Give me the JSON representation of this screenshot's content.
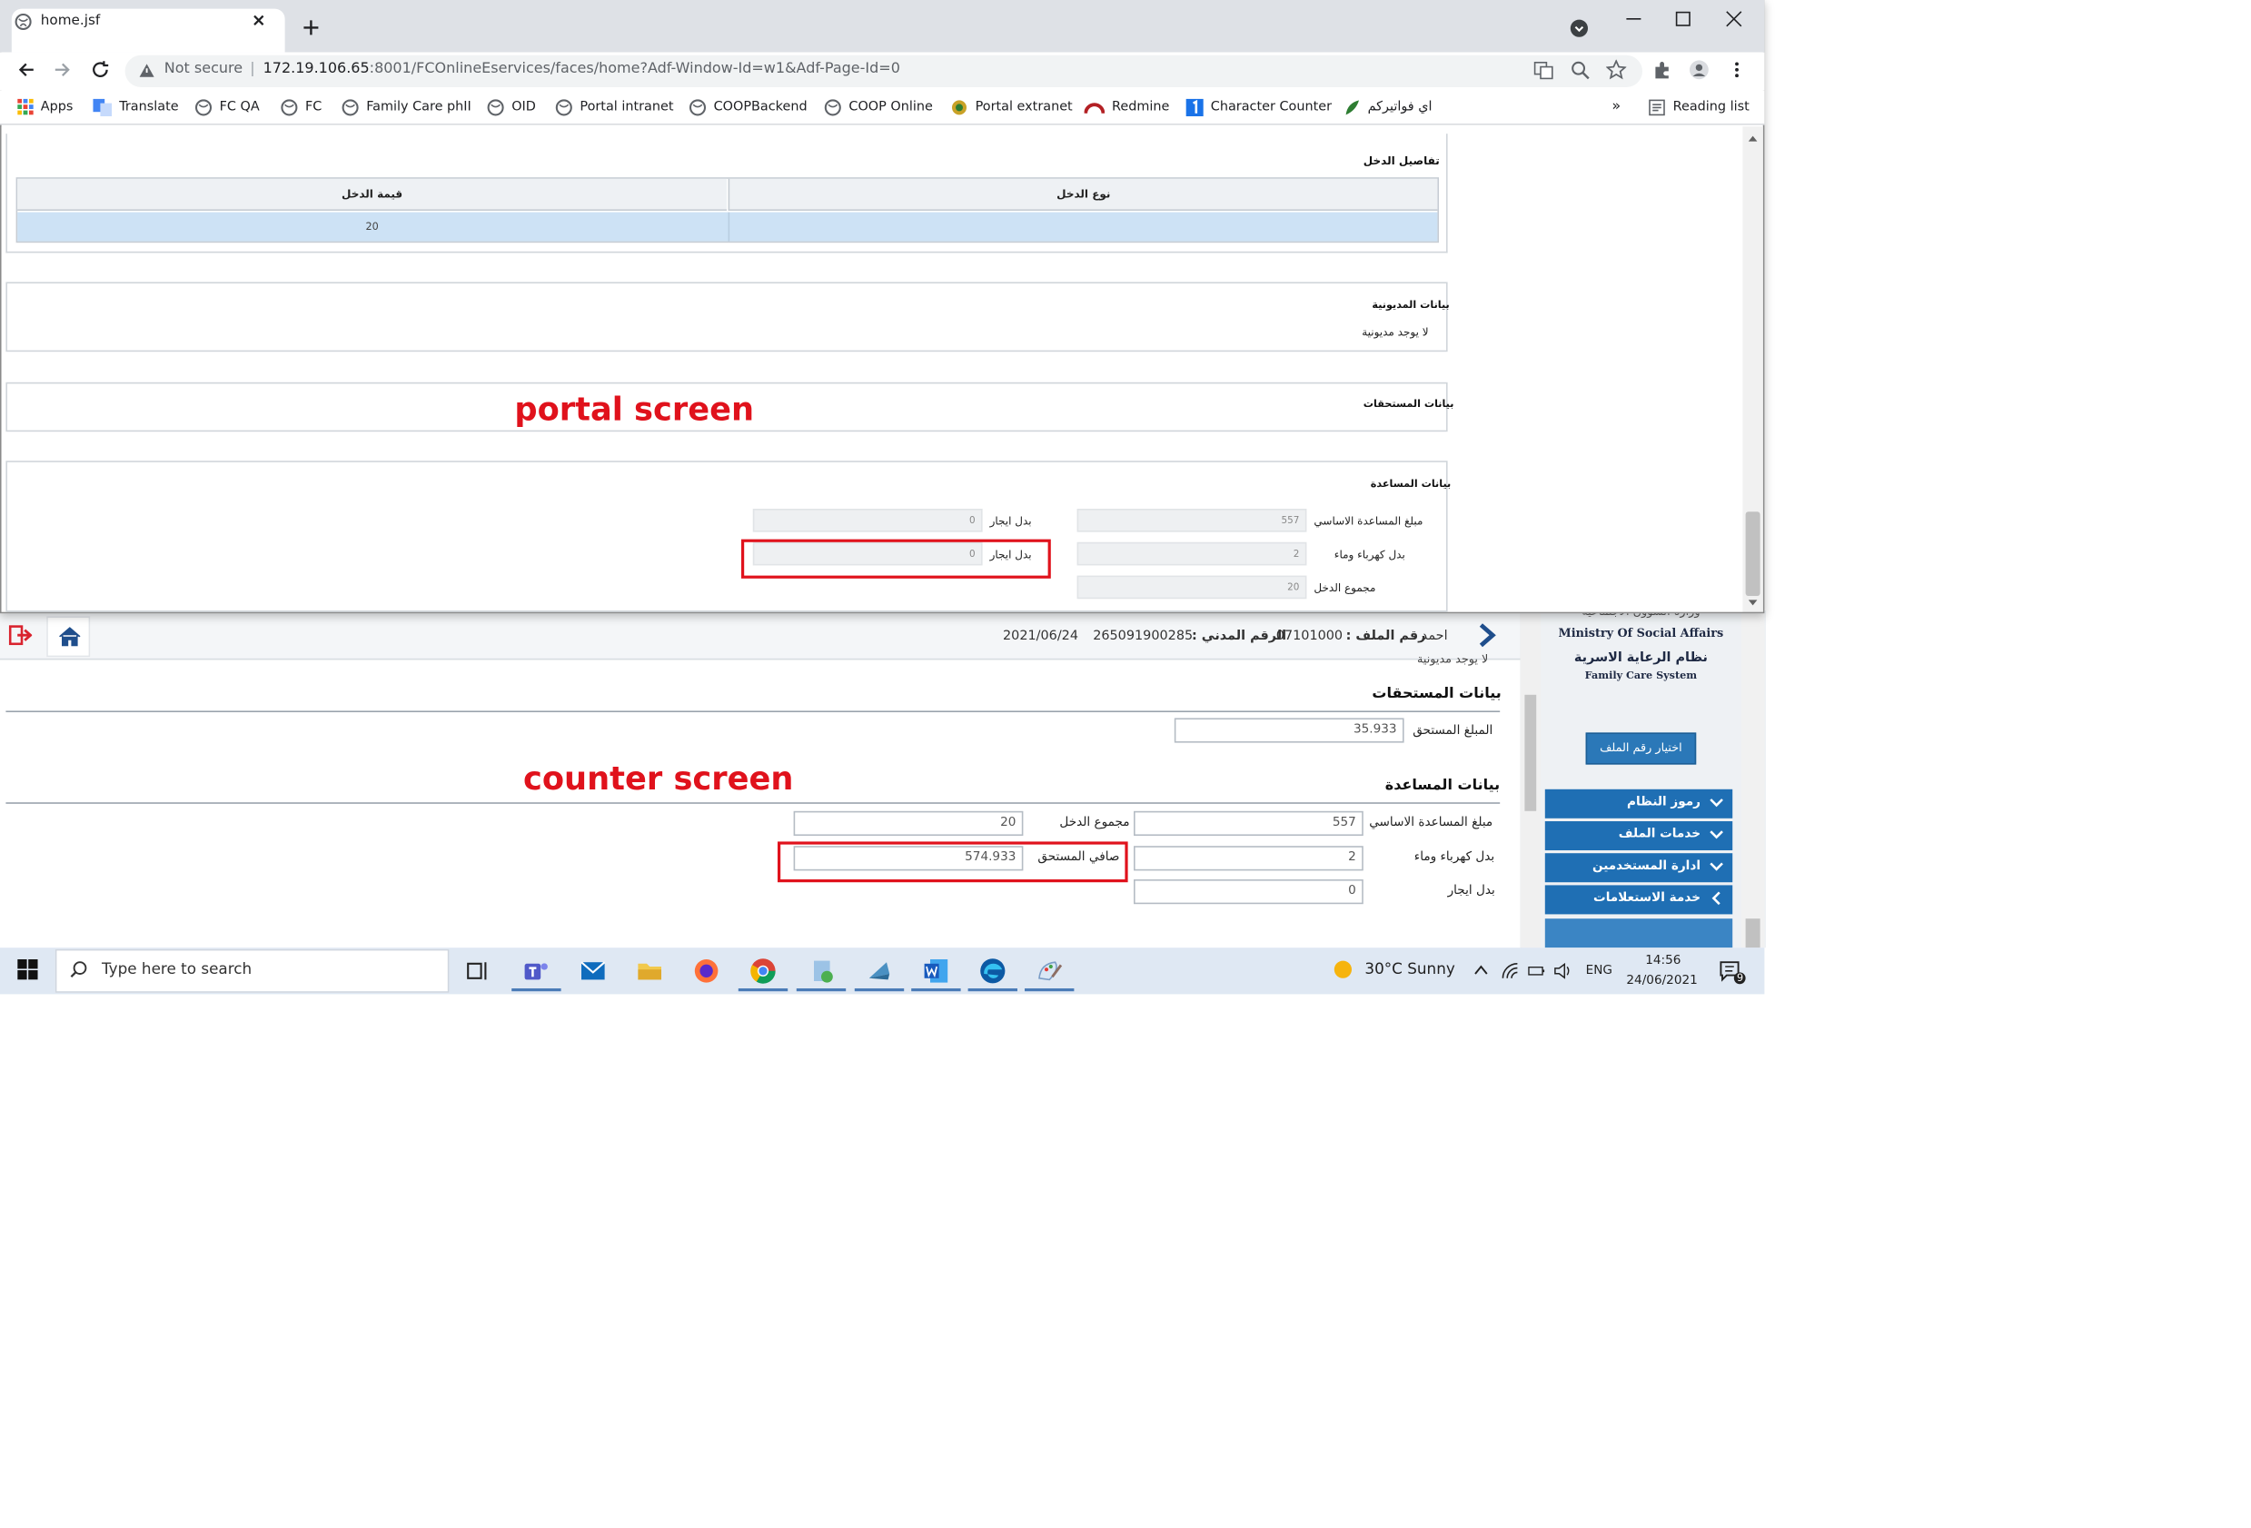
{
  "browser": {
    "tab_title": "home.jsf",
    "not_secure": "Not secure",
    "url_host": "172.19.106.65",
    "url_rest": ":8001/FCOnlineEservices/faces/home?Adf-Window-Id=w1&Adf-Page-Id=0",
    "bookmarks": [
      {
        "label": "Apps",
        "icon": "apps-grid-icon"
      },
      {
        "label": "Translate",
        "icon": "translate-icon"
      },
      {
        "label": "FC QA",
        "icon": "globe-icon"
      },
      {
        "label": "FC",
        "icon": "globe-icon"
      },
      {
        "label": "Family Care phII",
        "icon": "globe-icon"
      },
      {
        "label": "OID",
        "icon": "globe-icon"
      },
      {
        "label": "Portal intranet",
        "icon": "globe-icon"
      },
      {
        "label": "COOPBackend",
        "icon": "globe-icon"
      },
      {
        "label": "COOP Online",
        "icon": "globe-icon"
      },
      {
        "label": "Portal extranet",
        "icon": "emblem-icon"
      },
      {
        "label": "Redmine",
        "icon": "redmine-icon"
      },
      {
        "label": "Character Counter",
        "icon": "counter-1-icon"
      },
      {
        "label": "اي فواتيركم",
        "icon": "leaf-icon"
      }
    ],
    "overflow": "»",
    "reading_list": "Reading list"
  },
  "portal": {
    "income_details": {
      "title": "تفاصيل الدخل",
      "col_type": "نوع الدخل",
      "col_value": "قيمة الدخل",
      "rows": [
        {
          "type": "",
          "value": "20"
        }
      ]
    },
    "debt": {
      "title": "بيانات المديونية",
      "text": "لا يوجد مديونية"
    },
    "entitlements": {
      "title": "بيانات المستحقات"
    },
    "assistance": {
      "title": "بيانات المساعدة",
      "basic_label": "مبلغ المساعدة الاساسي",
      "basic_value": "557",
      "elec_label": "بدل كهرباء وماء",
      "elec_value": "2",
      "income_total_label": "مجموع الدخل",
      "income_total_value": "20",
      "rent_label_1": "بدل ايجار",
      "rent_value_1": "0",
      "rent_label_2": "بدل ايجار",
      "rent_value_2": "0"
    },
    "annotation": "portal screen"
  },
  "counter": {
    "user_name": "احمد",
    "file_no_label": "رقم الملف :",
    "file_no": "07101000",
    "civil_id_label": "الرقم المدني :",
    "civil_id": "265091900285",
    "date": "2021/06/24",
    "debt_text_cut": "لا يوجد مديونية",
    "entitlements_title": "بيانات المستحقات",
    "due_amount_label": "المبلغ المستحق",
    "due_amount_value": "35.933",
    "assistance_title": "بيانات المساعدة",
    "basic_label": "مبلغ المساعدة الاساسي",
    "basic_value": "557",
    "income_total_label": "مجموع الدخل",
    "income_total_value": "20",
    "elec_label": "بدل كهرباء وماء",
    "elec_value": "2",
    "net_due_label": "صافي المستحق",
    "net_due_value": "574.933",
    "rent_label": "بدل ايجار",
    "rent_value": "0",
    "annotation": "counter screen"
  },
  "sidebar": {
    "ministry_ar": "وزارة الشؤون الاجتماعية",
    "ministry_en": "Ministry Of Social Affairs",
    "system_ar": "نظام الرعاية الاسرية",
    "system_en": "Family Care System",
    "select_file_button": "اختيار رقم الملف",
    "menu": [
      {
        "label": "رموز النظام",
        "chevron": "chevron-down-icon"
      },
      {
        "label": "خدمات الملف",
        "chevron": "chevron-down-icon"
      },
      {
        "label": "ادارة المستخدمين",
        "chevron": "chevron-down-icon"
      },
      {
        "label": "خدمة الاستعلامات",
        "chevron": "chevron-left-icon"
      }
    ]
  },
  "taskbar": {
    "search_placeholder": "Type here to search",
    "weather": "30°C  Sunny",
    "lang": "ENG",
    "time": "14:56",
    "date": "24/06/2021",
    "notifications": "9"
  },
  "colors": {
    "accent_blue": "#1f6fb4",
    "annotation_red": "#e0121c",
    "selected_row": "#cde2f5"
  }
}
